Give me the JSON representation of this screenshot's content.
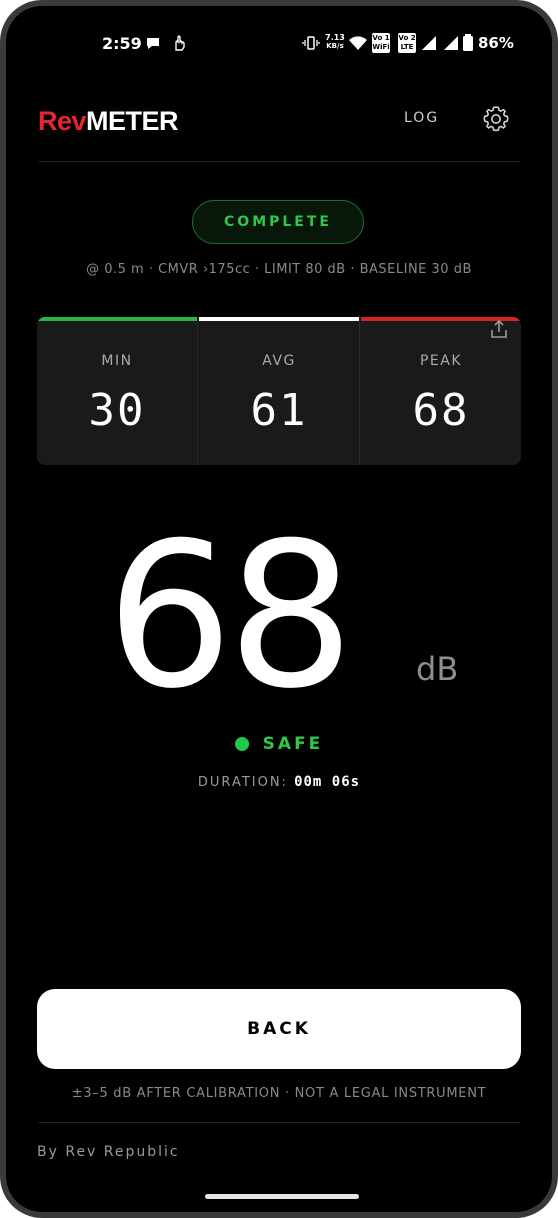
{
  "status_bar": {
    "time": "2:59",
    "net_speed_value": "7.13",
    "net_speed_unit": "KB/s",
    "volte1_top": "Vo 1",
    "volte1_bottom": "WiFi",
    "volte2_top": "Vo 2",
    "volte2_bottom": "LTE",
    "battery_percent": "86%"
  },
  "header": {
    "brand_rev": "Rev",
    "brand_meter": "METER",
    "log_label": "LOG"
  },
  "session": {
    "status": "COMPLETE",
    "params": "@ 0.5 m · CMVR ›175cc · LIMIT 80 dB · BASELINE 30 dB"
  },
  "stats": [
    {
      "label": "MIN",
      "value": "30",
      "color": "#2fb344"
    },
    {
      "label": "AVG",
      "value": "61",
      "color": "#ffffff"
    },
    {
      "label": "PEAK",
      "value": "68",
      "color": "#d8202a"
    }
  ],
  "reading": {
    "value": "68",
    "unit": "dB",
    "state": "SAFE",
    "state_color": "#1ec84a",
    "duration_label": "DURATION:",
    "duration_value": "00m 06s"
  },
  "footer": {
    "back_label": "BACK",
    "disclaimer": "±3–5 dB AFTER CALIBRATION · NOT A LEGAL INSTRUMENT",
    "credit": "By Rev Republic"
  }
}
